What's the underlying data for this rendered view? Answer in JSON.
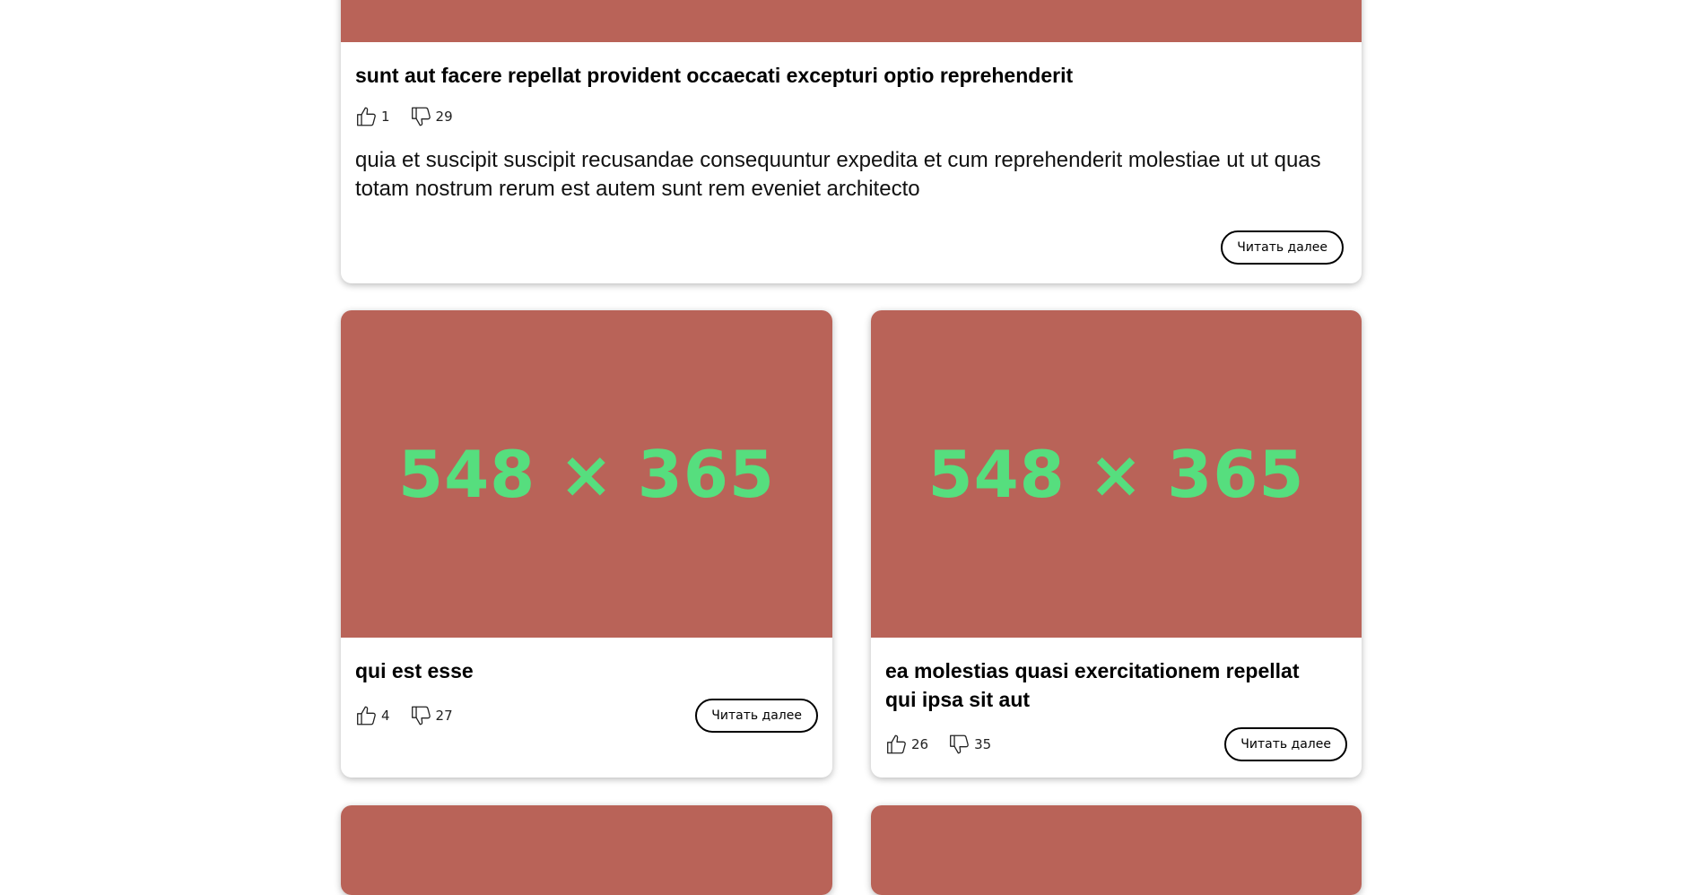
{
  "colors": {
    "cover_bg": "#B96358",
    "cover_text": "#56DE7E"
  },
  "posts": [
    {
      "title": "sunt aut facere repellat provident occaecati excepturi optio reprehenderit",
      "likes": "1",
      "dislikes": "29",
      "body": "quia et suscipit suscipit recusandae consequuntur expedita et cum reprehenderit molestiae ut ut quas totam nostrum rerum est autem sunt rem eveniet architecto",
      "read_more": "Читать далее"
    },
    {
      "cover_text": "548 × 365",
      "title": "qui est esse",
      "likes": "4",
      "dislikes": "27",
      "read_more": "Читать далее"
    },
    {
      "cover_text": "548 × 365",
      "title": "ea molestias quasi exercitationem repellat qui ipsa sit aut",
      "likes": "26",
      "dislikes": "35",
      "read_more": "Читать далее"
    }
  ],
  "icons": {
    "like": "thumbs-up-icon",
    "dislike": "thumbs-down-icon"
  }
}
